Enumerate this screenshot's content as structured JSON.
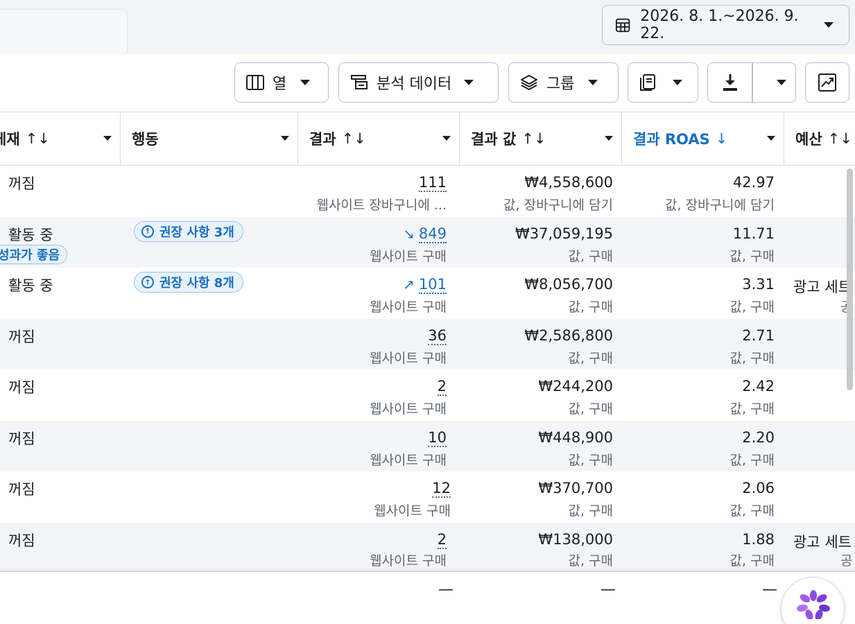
{
  "date_range": {
    "label": "2026. 8. 1.~2026. 9. 22.",
    "icon": "calendar-icon"
  },
  "toolbar": {
    "columns_label": "열",
    "breakdown_label": "분석 데이터",
    "group_label": "그룹",
    "reports_icon": "report-icon",
    "export_icon": "download-icon",
    "chart_icon": "trend-chart-icon"
  },
  "headers": {
    "status": "게재",
    "status_arrows": "↑↓",
    "action": "행동",
    "result": "결과",
    "result_arrows": "↑↓",
    "result_value": "결과 값",
    "result_value_arrows": "↑↓",
    "roas": "결과 ROAS",
    "roas_arrow": "↓",
    "budget": "예산",
    "budget_arrows": "↑↓"
  },
  "rows": [
    {
      "status": "꺼짐",
      "result": "111",
      "result_sub": "웹사이트 장바구니에 ...",
      "value": "₩4,558,600",
      "value_sub": "값, 장바구니에 담기",
      "roas": "42.97",
      "roas_sub": "값, 장바구니에 담기"
    },
    {
      "status": "활동 중",
      "performance": "성과가 좋음",
      "recommendation": "권장 사항 3개",
      "trend": "↘",
      "result": "849",
      "result_sub": "웹사이트 구매",
      "value": "₩37,059,195",
      "value_sub": "값, 구매",
      "roas": "11.71",
      "roas_sub": "값, 구매"
    },
    {
      "status": "활동 중",
      "recommendation": "권장 사항 8개",
      "trend": "↗",
      "result": "101",
      "result_sub": "웹사이트 구매",
      "value": "₩8,056,700",
      "value_sub": "값, 구매",
      "roas": "3.31",
      "roas_sub": "값, 구매",
      "budget": "광고 세트",
      "budget_sub": "공"
    },
    {
      "status": "꺼짐",
      "result": "36",
      "result_sub": "웹사이트 구매",
      "value": "₩2,586,800",
      "value_sub": "값, 구매",
      "roas": "2.71",
      "roas_sub": "값, 구매"
    },
    {
      "status": "꺼짐",
      "result": "2",
      "result_sub": "웹사이트 구매",
      "value": "₩244,200",
      "value_sub": "값, 구매",
      "roas": "2.42",
      "roas_sub": "값, 구매"
    },
    {
      "status": "꺼짐",
      "result": "10",
      "result_sub": "웹사이트 구매",
      "value": "₩448,900",
      "value_sub": "값, 구매",
      "roas": "2.20",
      "roas_sub": "값, 구매"
    },
    {
      "status": "꺼짐",
      "result": "12",
      "result_sub": "웹사이트 구매",
      "value": "₩370,700",
      "value_sub": "값, 구매",
      "roas": "2.06",
      "roas_sub": "값, 구매"
    },
    {
      "status": "꺼짐",
      "result": "2",
      "result_sub": "웹사이트 구매",
      "value": "₩138,000",
      "value_sub": "값, 구매",
      "roas": "1.88",
      "roas_sub": "값, 구매",
      "budget": "광고 세트",
      "budget_sub": "공"
    }
  ],
  "footer": {
    "result": "—",
    "value": "—",
    "roas": "—"
  },
  "colors": {
    "accent": "#1a6fc1",
    "border": "#b8bfcb",
    "alt_row": "#f4f5f8"
  }
}
